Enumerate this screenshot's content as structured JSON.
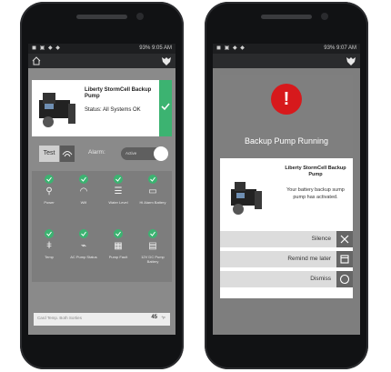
{
  "phone1": {
    "status_bar": {
      "time": "9:05 AM",
      "battery": "93%"
    },
    "device": {
      "name": "Liberty StormCell Backup Pump",
      "status": "Status: All Systems OK"
    },
    "controls": {
      "test_label": "Test",
      "alarm_label": "Alarm:",
      "alarm_value": "Active"
    },
    "tiles": [
      {
        "icon": "power-plug-icon",
        "label": "Power"
      },
      {
        "icon": "wifi-icon",
        "label": "Wifi"
      },
      {
        "icon": "water-level-icon",
        "label": "Water Level"
      },
      {
        "icon": "battery-icon",
        "label": "Hi Alarm Battery"
      },
      {
        "icon": "thermometer-icon",
        "label": "Temp"
      },
      {
        "icon": "pulse-icon",
        "label": "AC Pump Status"
      },
      {
        "icon": "pump-icon",
        "label": "Pump Fault"
      },
      {
        "icon": "battery-pump-icon",
        "label": "12V DC Pump Battery"
      }
    ],
    "bottom": {
      "text": "Card Temp. Both Sorties",
      "temp_value": "45",
      "temp_unit": "°F"
    }
  },
  "phone2": {
    "status_bar": {
      "time": "9:07 AM",
      "battery": "93%"
    },
    "dialog": {
      "title": "Backup Pump Running",
      "device_name": "Liberty StormCell Backup Pump",
      "message": "Your battery backup sump pump has activated."
    },
    "actions": {
      "silence": "Silence",
      "remind": "Remind me later",
      "dismiss": "Dismiss"
    }
  },
  "colors": {
    "ok_green": "#3cb371",
    "alert_red": "#d7191c",
    "app_gray": "#8a8a8a"
  }
}
